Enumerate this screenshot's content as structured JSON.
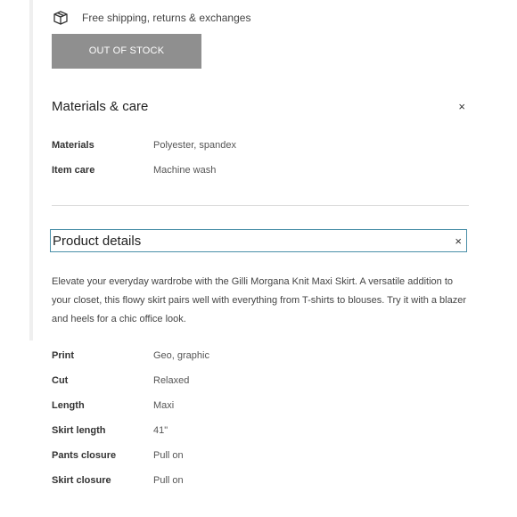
{
  "shipping": {
    "icon": "box-return-icon",
    "text": "Free shipping, returns & exchanges"
  },
  "purchase": {
    "button_label": "OUT OF STOCK"
  },
  "materials_care": {
    "title": "Materials & care",
    "close_glyph": "×",
    "rows": [
      {
        "label": "Materials",
        "value": "Polyester, spandex"
      },
      {
        "label": "Item care",
        "value": "Machine wash"
      }
    ]
  },
  "product_details": {
    "title": "Product details",
    "close_glyph": "×",
    "description": "Elevate your everyday wardrobe with the Gilli Morgana Knit Maxi Skirt. A versatile addition to your closet, this flowy skirt pairs well with everything from T-shirts to blouses. Try it with a blazer and heels for a chic office look.",
    "rows": [
      {
        "label": "Print",
        "value": "Geo, graphic"
      },
      {
        "label": "Cut",
        "value": "Relaxed"
      },
      {
        "label": "Length",
        "value": "Maxi"
      },
      {
        "label": "Skirt length",
        "value": "41\""
      },
      {
        "label": "Pants closure",
        "value": "Pull on"
      },
      {
        "label": "Skirt closure",
        "value": "Pull on"
      }
    ]
  },
  "colors": {
    "button_bg": "#8f8f8f",
    "focus_border": "#4a8fa8",
    "text": "#2e2e2e"
  }
}
